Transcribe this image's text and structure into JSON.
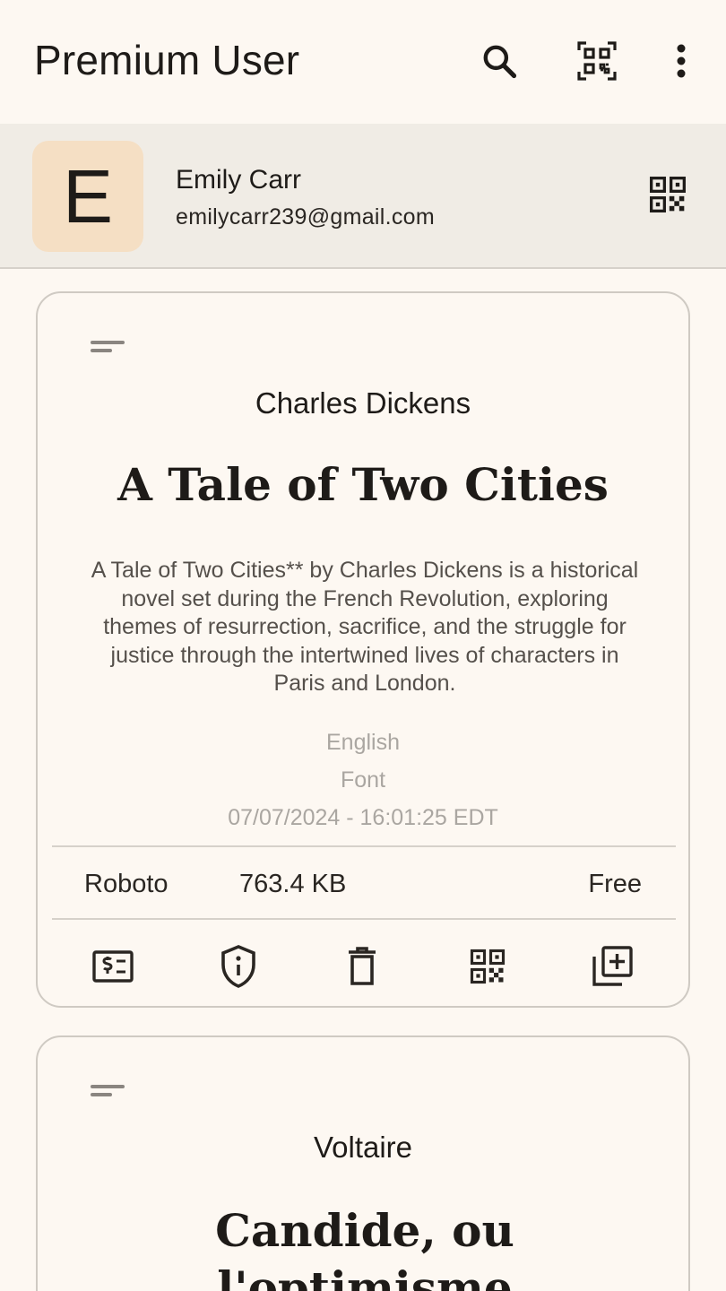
{
  "appbar": {
    "title": "Premium User",
    "icons": [
      "search-icon",
      "qr-scan-icon",
      "more-vert-icon"
    ]
  },
  "user": {
    "initial": "E",
    "name": "Emily Carr",
    "email": "emilycarr239@gmail.com",
    "qr_icon": "qr-code-icon"
  },
  "books": [
    {
      "author": "Charles Dickens",
      "title": "A Tale of Two Cities",
      "description": "A Tale of Two Cities** by Charles Dickens is a historical novel set during the French Revolution, exploring themes of resurrection, sacrifice, and the struggle for justice through the intertwined lives of characters in Paris and London.",
      "language": "English",
      "font_label": "Font",
      "timestamp": "07/07/2024 - 16:01:25 EDT",
      "font": "Roboto",
      "size": "763.4 KB",
      "price": "Free",
      "actions": [
        "price-tag-icon",
        "info-shield-icon",
        "delete-icon",
        "qr-code-icon",
        "add-to-library-icon"
      ]
    },
    {
      "author": "Voltaire",
      "title": "Candide, ou l'optimisme"
    }
  ],
  "colors": {
    "background": "#fdf8f2",
    "header_row": "#f0ece5",
    "avatar": "#f5dfc4",
    "text": "#1e1b18",
    "muted": "#aaa6a1"
  }
}
